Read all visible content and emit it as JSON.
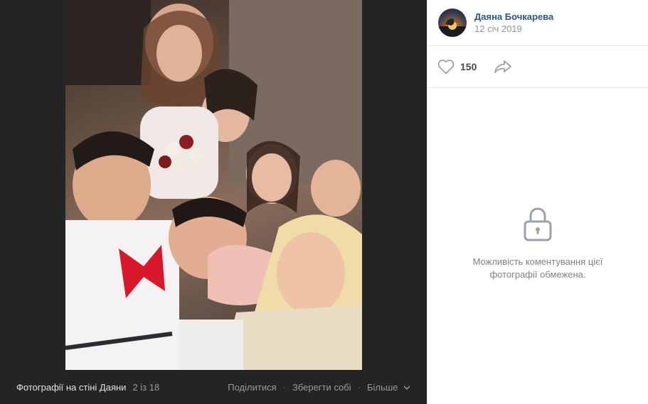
{
  "bottom_bar": {
    "album_title": "Фотографії на стіні Даяни",
    "counter": "2 із 18",
    "actions": {
      "share": "Поділитися",
      "save": "Зберегти собі",
      "more": "Більше"
    }
  },
  "post": {
    "author": "Даяна Бочкарева",
    "date": "12 січ 2019",
    "likes": "150",
    "comments_locked": "Можливість коментування цієї фотографії обмежена."
  },
  "icons": {
    "like": "heart-outline-icon",
    "share": "share-arrow-icon",
    "lock": "lock-icon",
    "more": "chevron-down-icon"
  },
  "colors": {
    "viewer_background": "#242424",
    "link": "#2a5885",
    "muted": "#939393",
    "icon": "#99a2ad"
  }
}
